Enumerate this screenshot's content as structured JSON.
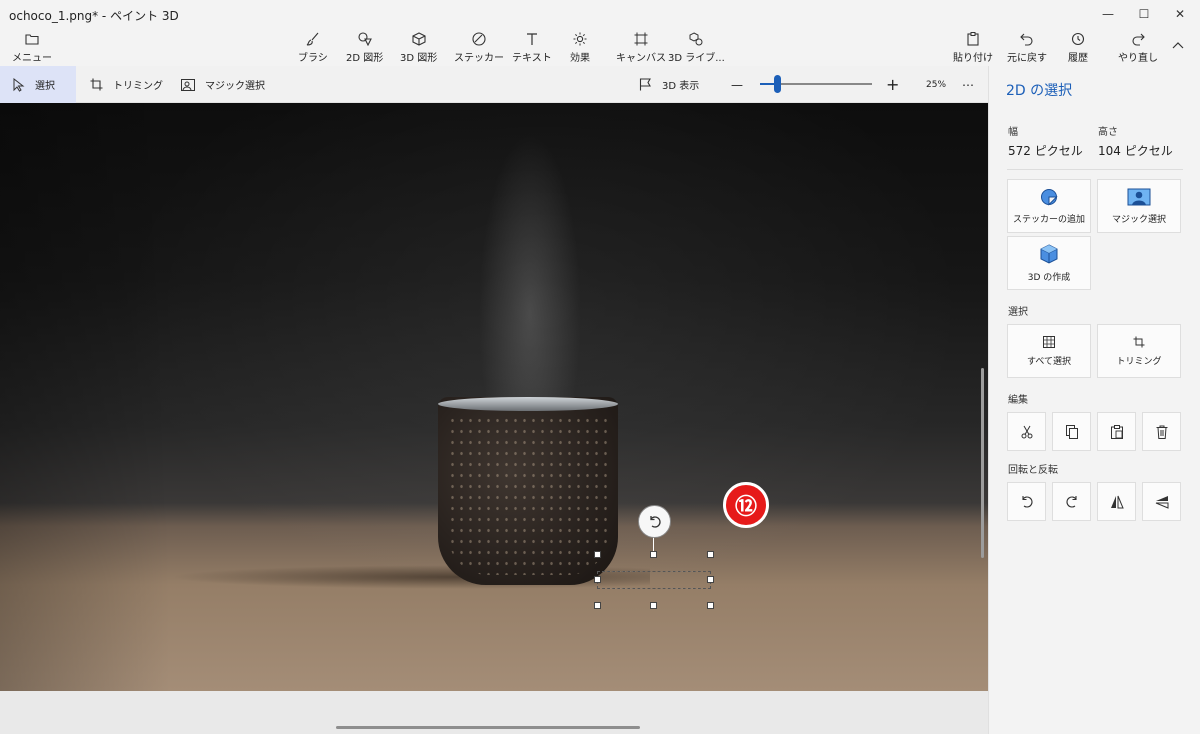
{
  "window": {
    "title": "ochoco_1.png* - ペイント 3D",
    "minimize": "—",
    "maximize": "☐",
    "close": "✕"
  },
  "ribbon": {
    "menu": "メニュー",
    "brush": "ブラシ",
    "shapes2d": "2D 図形",
    "shapes3d": "3D 図形",
    "stickers": "ステッカー",
    "text": "テキスト",
    "effects": "効果",
    "canvas": "キャンバス",
    "library3d": "3D ライブ...",
    "paste": "貼り付け",
    "undo": "元に戻す",
    "history": "履歴",
    "redo": "やり直し"
  },
  "toolbar": {
    "select": "選択",
    "crop": "トリミング",
    "magic_select": "マジック選択",
    "view3d": "3D 表示",
    "zoom_minus": "—",
    "zoom_plus": "+",
    "zoom": "25%",
    "zoom_level": 0.05,
    "more": "⋯"
  },
  "canvas": {
    "badge": "⑫"
  },
  "panel": {
    "title": "2D の選択",
    "width_label": "幅",
    "width_value": "572 ピクセル",
    "height_label": "高さ",
    "height_value": "104 ピクセル",
    "add_sticker": "ステッカーの追加",
    "magic_select": "マジック選択",
    "make_3d": "3D の作成",
    "select_section": "選択",
    "select_all": "すべて選択",
    "crop": "トリミング",
    "edit_section": "編集",
    "rotate_section": "回転と反転"
  }
}
